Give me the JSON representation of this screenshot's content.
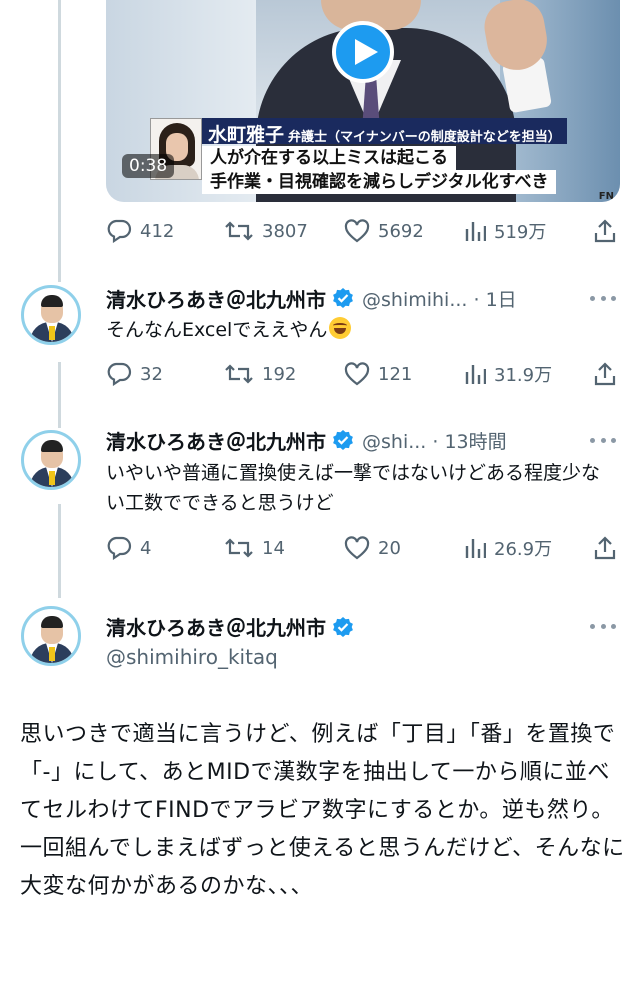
{
  "video": {
    "duration": "0:38",
    "caption_name": "水町雅子",
    "caption_role": "弁護士（マイナンバーの制度設計などを担当）",
    "caption_line1": "人が介在する以上ミスは起こる",
    "caption_line2": "手作業・目視確認を減らしデジタル化すべき",
    "corner_mark": "FN"
  },
  "first_actions": {
    "replies": "412",
    "retweets": "3807",
    "likes": "5692",
    "views": "519万"
  },
  "replies": [
    {
      "display_name": "清水ひろあき＠北九州市",
      "handle_time": "@shimihi... · 1日",
      "text": "そんなんExcelでええやん",
      "emoji": "rolling-on-floor-laughing",
      "actions": {
        "replies": "32",
        "retweets": "192",
        "likes": "121",
        "views": "31.9万"
      }
    },
    {
      "display_name": "清水ひろあき＠北九州市",
      "handle_time": "@shi... · 13時間",
      "text": "いやいや普通に置換使えば一撃ではないけどある程度少ない工数でできると思うけど",
      "actions": {
        "replies": "4",
        "retweets": "14",
        "likes": "20",
        "views": "26.9万"
      }
    }
  ],
  "main_tweet": {
    "display_name": "清水ひろあき＠北九州市",
    "handle": "@shimihiro_kitaq",
    "text": "思いつきで適当に言うけど、例えば「丁目」「番」を置換で「-」にして、あとMIDで漢数字を抽出して一から順に並べてセルわけてFINDでアラビア数字にするとか。逆も然り。一回組んでしまえばずっと使えると思うんだけど、そんなに大変な何かがあるのかな、、、"
  },
  "colors": {
    "accent": "#1d9bf0",
    "muted": "#536471",
    "thread_line": "#cfd9de"
  }
}
